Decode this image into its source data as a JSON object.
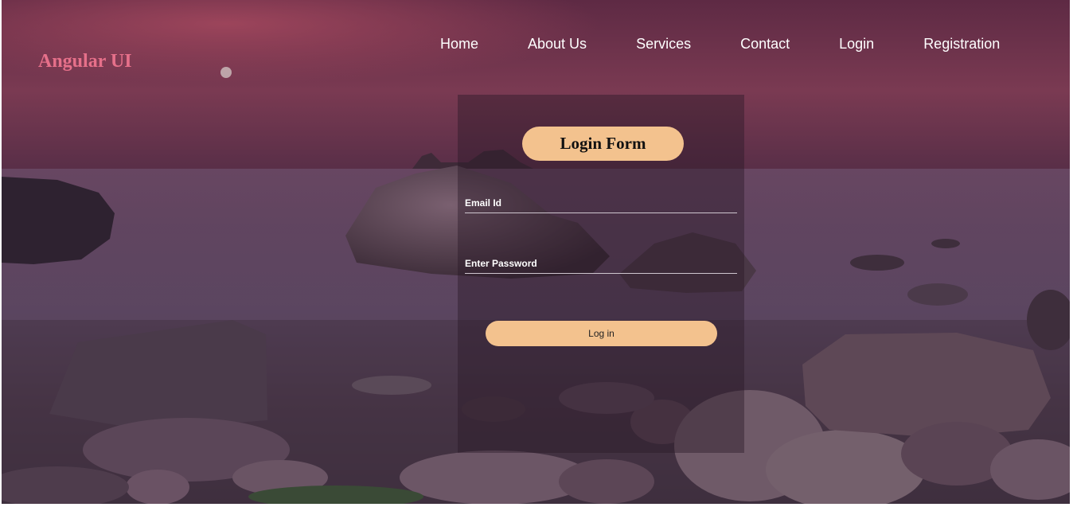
{
  "brand": {
    "name": "Angular UI",
    "color": "#e6708a"
  },
  "nav": {
    "items": [
      {
        "label": "Home"
      },
      {
        "label": "About Us"
      },
      {
        "label": "Services"
      },
      {
        "label": "Contact"
      },
      {
        "label": "Login"
      },
      {
        "label": "Registration"
      }
    ]
  },
  "login_form": {
    "title": "Login Form",
    "email": {
      "placeholder": "Email Id",
      "value": ""
    },
    "password": {
      "placeholder": "Enter Password",
      "value": ""
    },
    "submit_label": "Log in"
  },
  "colors": {
    "accent": "#f3c28e",
    "panel_overlay": "rgba(40, 25, 38, 0.42)",
    "nav_text": "#ffffff"
  }
}
